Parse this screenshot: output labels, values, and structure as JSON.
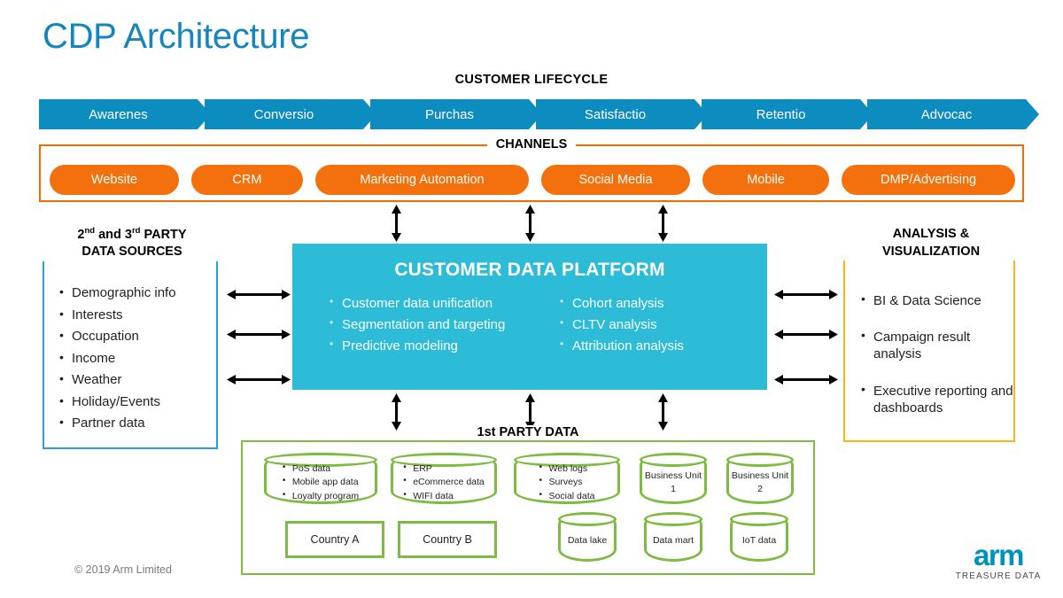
{
  "page": {
    "title": "CDP Architecture",
    "copyright": "© 2019 Arm Limited"
  },
  "colors": {
    "title_blue": "#1486bb",
    "lifecycle_blue": "#0c8cbf",
    "channels_orange": "#f26a00",
    "pill_orange": "#f4700c",
    "cdp_cyan": "#2cbcd8",
    "panel_left_blue": "#2e9fd4",
    "panel_right_yellow": "#fcb415",
    "first_party_green": "#7dbb42",
    "logo_blue": "#0091bd"
  },
  "lifecycle": {
    "caption": "CUSTOMER LIFECYCLE",
    "stages": [
      {
        "label": "Awarenes"
      },
      {
        "label": "Conversio"
      },
      {
        "label": "Purchas"
      },
      {
        "label": "Satisfactio"
      },
      {
        "label": "Retentio"
      },
      {
        "label": "Advocac"
      }
    ]
  },
  "channels": {
    "caption": "CHANNELS",
    "items": [
      {
        "label": "Website"
      },
      {
        "label": "CRM"
      },
      {
        "label": "Marketing Automation"
      },
      {
        "label": "Social Media"
      },
      {
        "label": "Mobile"
      },
      {
        "label": "DMP/Advertising"
      }
    ]
  },
  "left_panel": {
    "title_line1_pre": "2",
    "title_line1_sup": "nd",
    "title_line1_mid": " and 3",
    "title_line1_sup2": "rd",
    "title_line1_post": " PARTY",
    "title_line2": "DATA SOURCES",
    "items": [
      "Demographic info",
      "Interests",
      "Occupation",
      "Income",
      "Weather",
      "Holiday/Events",
      "Partner data"
    ]
  },
  "cdp": {
    "title": "CUSTOMER DATA PLATFORM",
    "column_left": [
      "Customer data unification",
      "Segmentation and targeting",
      "Predictive modeling"
    ],
    "column_right": [
      "Cohort analysis",
      "CLTV analysis",
      "Attribution analysis"
    ]
  },
  "right_panel": {
    "title_line1": "ANALYSIS &",
    "title_line2": "VISUALIZATION",
    "items": [
      "BI & Data Science",
      "Campaign result analysis",
      "Executive reporting and dashboards"
    ]
  },
  "first_party": {
    "caption": "1st PARTY DATA",
    "cylinders_row1": [
      {
        "type": "list",
        "items": [
          "PoS data",
          "Mobile app data",
          "Loyalty program"
        ]
      },
      {
        "type": "list",
        "items": [
          "ERP",
          "eCommerce data",
          "WIFI data"
        ]
      },
      {
        "type": "list",
        "items": [
          "Web logs",
          "Surveys",
          "Social data"
        ]
      },
      {
        "type": "center",
        "label": "Business Unit 1"
      },
      {
        "type": "center",
        "label": "Business Unit 2"
      }
    ],
    "rects_row2": [
      {
        "label": "Country A"
      },
      {
        "label": "Country B"
      }
    ],
    "cylinders_row2": [
      {
        "label": "Data lake"
      },
      {
        "label": "Data mart"
      },
      {
        "label": "IoT data"
      }
    ]
  },
  "logo": {
    "wordmark": "arm",
    "subtitle": "TREASURE DATA"
  }
}
